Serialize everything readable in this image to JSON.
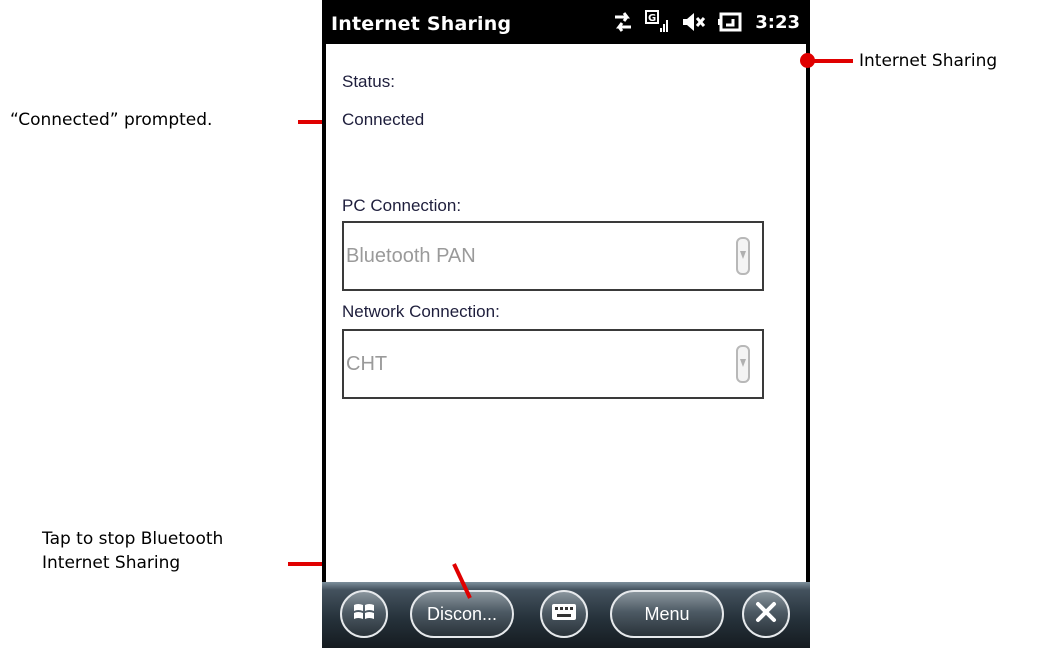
{
  "window": {
    "title": "Internet Sharing",
    "clock": "3:23"
  },
  "form": {
    "status_label": "Status:",
    "status_value": "Connected",
    "pc_connection_label": "PC Connection:",
    "pc_connection_value": "Bluetooth PAN",
    "network_connection_label": "Network Connection:",
    "network_connection_value": "CHT"
  },
  "softkeys": {
    "left_label": "Discon...",
    "right_label": "Menu"
  },
  "annotations": {
    "connected_note": "“Connected” prompted.",
    "title_note": "Internet Sharing",
    "disconnect_note_line1": "Tap to stop Bluetooth",
    "disconnect_note_line2": "Internet Sharing"
  },
  "colors": {
    "annotation_line": "#e00000",
    "titlebar": "#000000"
  }
}
